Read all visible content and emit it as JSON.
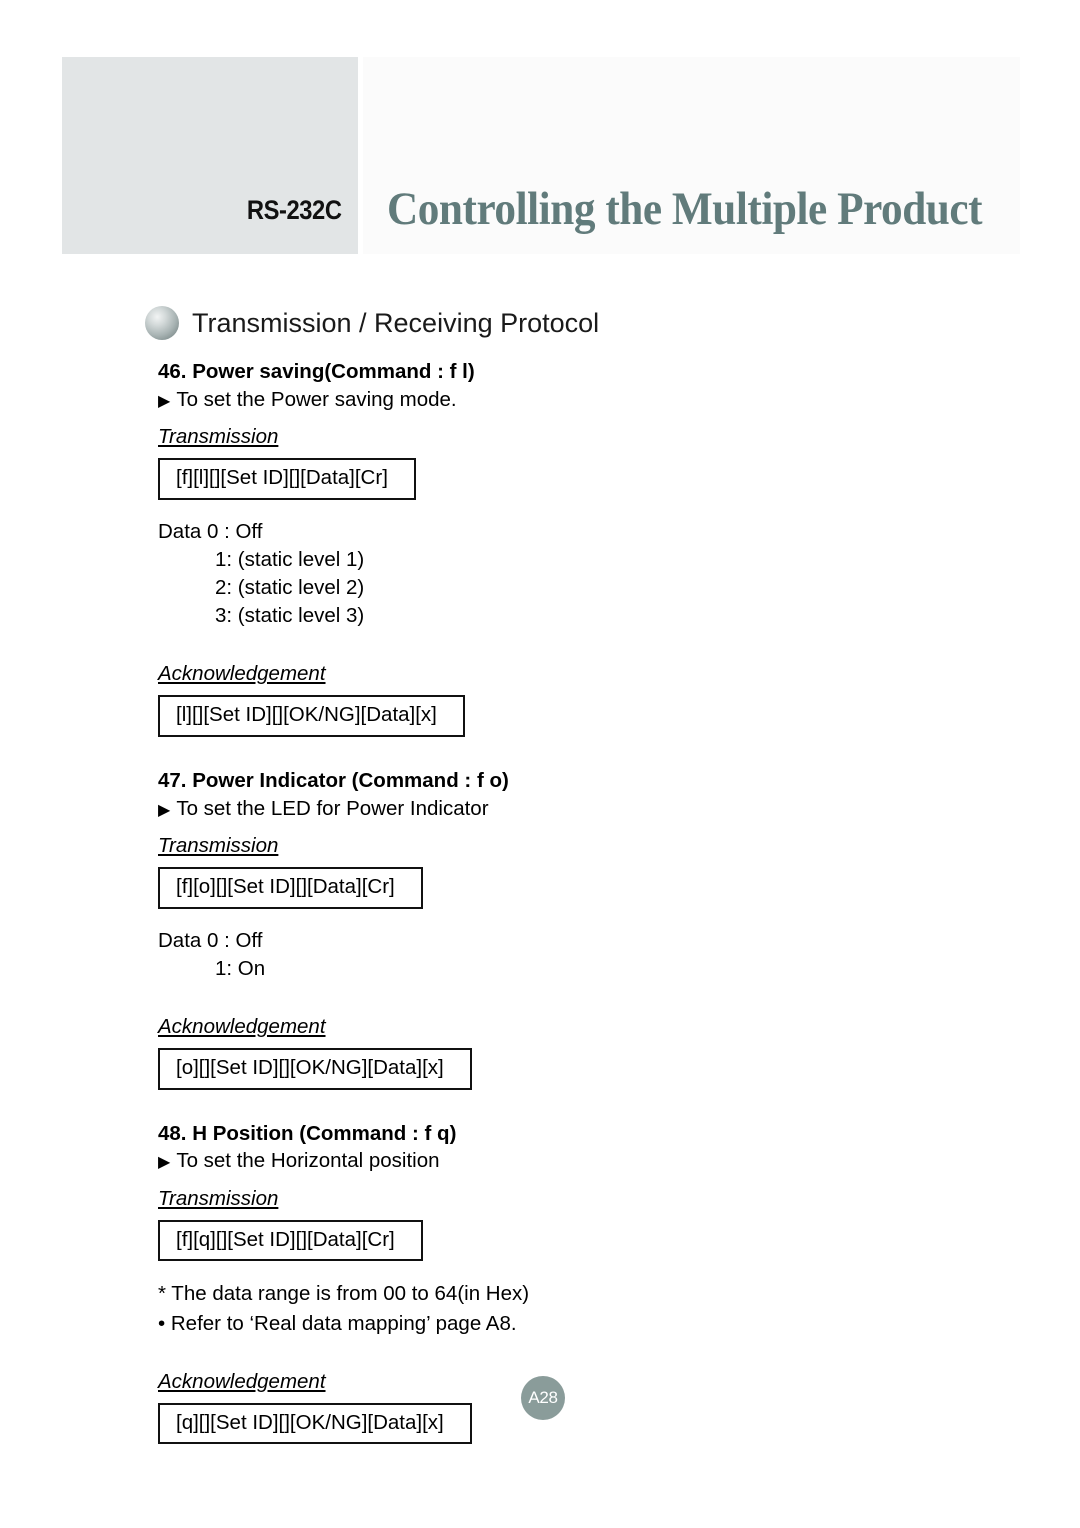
{
  "header": {
    "doc_standard": "RS-232C",
    "title": "Controlling the Multiple Product",
    "left_block_color": "#e2e5e6",
    "title_color": "#617b7b"
  },
  "protocol_section": {
    "icon": "sphere-bullet-icon",
    "heading": "Transmission / Receiving Protocol"
  },
  "sections": [
    {
      "id": "46",
      "title": "46. Power saving(Command : f l)",
      "description": "To set the Power saving mode.",
      "transmission_label": "Transmission",
      "transmission_code": "[f][l][][Set ID][][Data][Cr]",
      "data_lines": [
        "Data 0 : Off",
        "1: (static level 1)",
        "2: (static level 2)",
        "3: (static level 3)"
      ],
      "acknowledgement_label": "Acknowledgement",
      "acknowledgement_code": "[l][][Set ID][][OK/NG][Data][x]"
    },
    {
      "id": "47",
      "title": "47. Power Indicator (Command : f o)",
      "description": "To set the LED for Power Indicator",
      "transmission_label": "Transmission",
      "transmission_code": "[f][o][][Set ID][][Data][Cr]",
      "data_lines": [
        "Data 0 : Off",
        "1: On"
      ],
      "acknowledgement_label": "Acknowledgement",
      "acknowledgement_code": "[o][][Set ID][][OK/NG][Data][x]"
    },
    {
      "id": "48",
      "title": "48. H Position (Command : f q)",
      "description": "To set the Horizontal position",
      "transmission_label": "Transmission",
      "transmission_code": "[f][q][][Set ID][][Data][Cr]",
      "notes": [
        "* The data range is from 00 to 64(in Hex)",
        "• Refer to ‘Real data mapping’ page A8."
      ],
      "acknowledgement_label": "Acknowledgement",
      "acknowledgement_code": "[q][][Set ID][][OK/NG][Data][x]"
    }
  ],
  "footer": {
    "page_number": "A28",
    "badge_color": "#8a9c9a"
  },
  "glyphs": {
    "triangle_bullet": "▶"
  }
}
